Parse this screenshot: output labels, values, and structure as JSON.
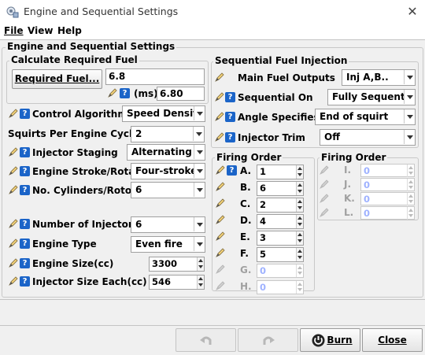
{
  "window": {
    "title": "Engine and Sequential Settings"
  },
  "menu": {
    "file": "File",
    "view": "View",
    "help": "Help"
  },
  "panel_title": "Engine and Sequential Settings",
  "calc": {
    "title": "Calculate Required Fuel",
    "button": "Required Fuel...",
    "req_fuel_value": "6.8",
    "ms_label": "(ms)",
    "ms_value": "6.80"
  },
  "left": {
    "control_algorithm": {
      "label": "Control Algorithm",
      "value": "Speed Density"
    },
    "squirts": {
      "label": "Squirts Per Engine Cycle",
      "value": "2"
    },
    "injector_staging": {
      "label": "Injector Staging",
      "value": "Alternating"
    },
    "engine_stroke": {
      "label": "Engine Stroke/Rotary",
      "value": "Four-stroke"
    },
    "no_cylinders": {
      "label": "No. Cylinders/Rotors",
      "value": "6"
    },
    "num_injectors": {
      "label": "Number of Injectors",
      "value": "6"
    },
    "engine_type": {
      "label": "Engine Type",
      "value": "Even fire"
    },
    "engine_size": {
      "label": "Engine Size(cc)",
      "value": "3300"
    },
    "injector_size": {
      "label": "Injector Size Each(cc)",
      "value": "546"
    }
  },
  "seq": {
    "title": "Sequential Fuel Injection",
    "main_outputs": {
      "label": "Main Fuel Outputs",
      "value": "Inj A,B.."
    },
    "seq_on": {
      "label": "Sequential On",
      "value": "Fully Sequential"
    },
    "angle": {
      "label": "Angle Specifies:",
      "value": "End of squirt"
    },
    "trim": {
      "label": "Injector Trim",
      "value": "Off"
    }
  },
  "firing1": {
    "title": "Firing Order",
    "rows": [
      {
        "label": "A.",
        "value": "1"
      },
      {
        "label": "B.",
        "value": "6"
      },
      {
        "label": "C.",
        "value": "2"
      },
      {
        "label": "D.",
        "value": "4"
      },
      {
        "label": "E.",
        "value": "3"
      },
      {
        "label": "F.",
        "value": "5"
      },
      {
        "label": "G.",
        "value": "0"
      },
      {
        "label": "H.",
        "value": "0"
      }
    ]
  },
  "firing2": {
    "title": "Firing Order",
    "rows": [
      {
        "label": "I.",
        "value": "0"
      },
      {
        "label": "J.",
        "value": "0"
      },
      {
        "label": "K.",
        "value": "0"
      },
      {
        "label": "L.",
        "value": "0"
      }
    ]
  },
  "buttons": {
    "burn": "Burn",
    "close": "Close"
  },
  "colors": {
    "help_icon": "#1b64c8",
    "disabled_value": "#a8b4ff",
    "panel_bg": "#f0f0f0"
  },
  "icons": [
    "app-icon",
    "close-icon",
    "pencil-icon",
    "help-icon",
    "undo-icon",
    "redo-icon",
    "burn-icon",
    "spinner-icon",
    "dropdown-icon"
  ]
}
